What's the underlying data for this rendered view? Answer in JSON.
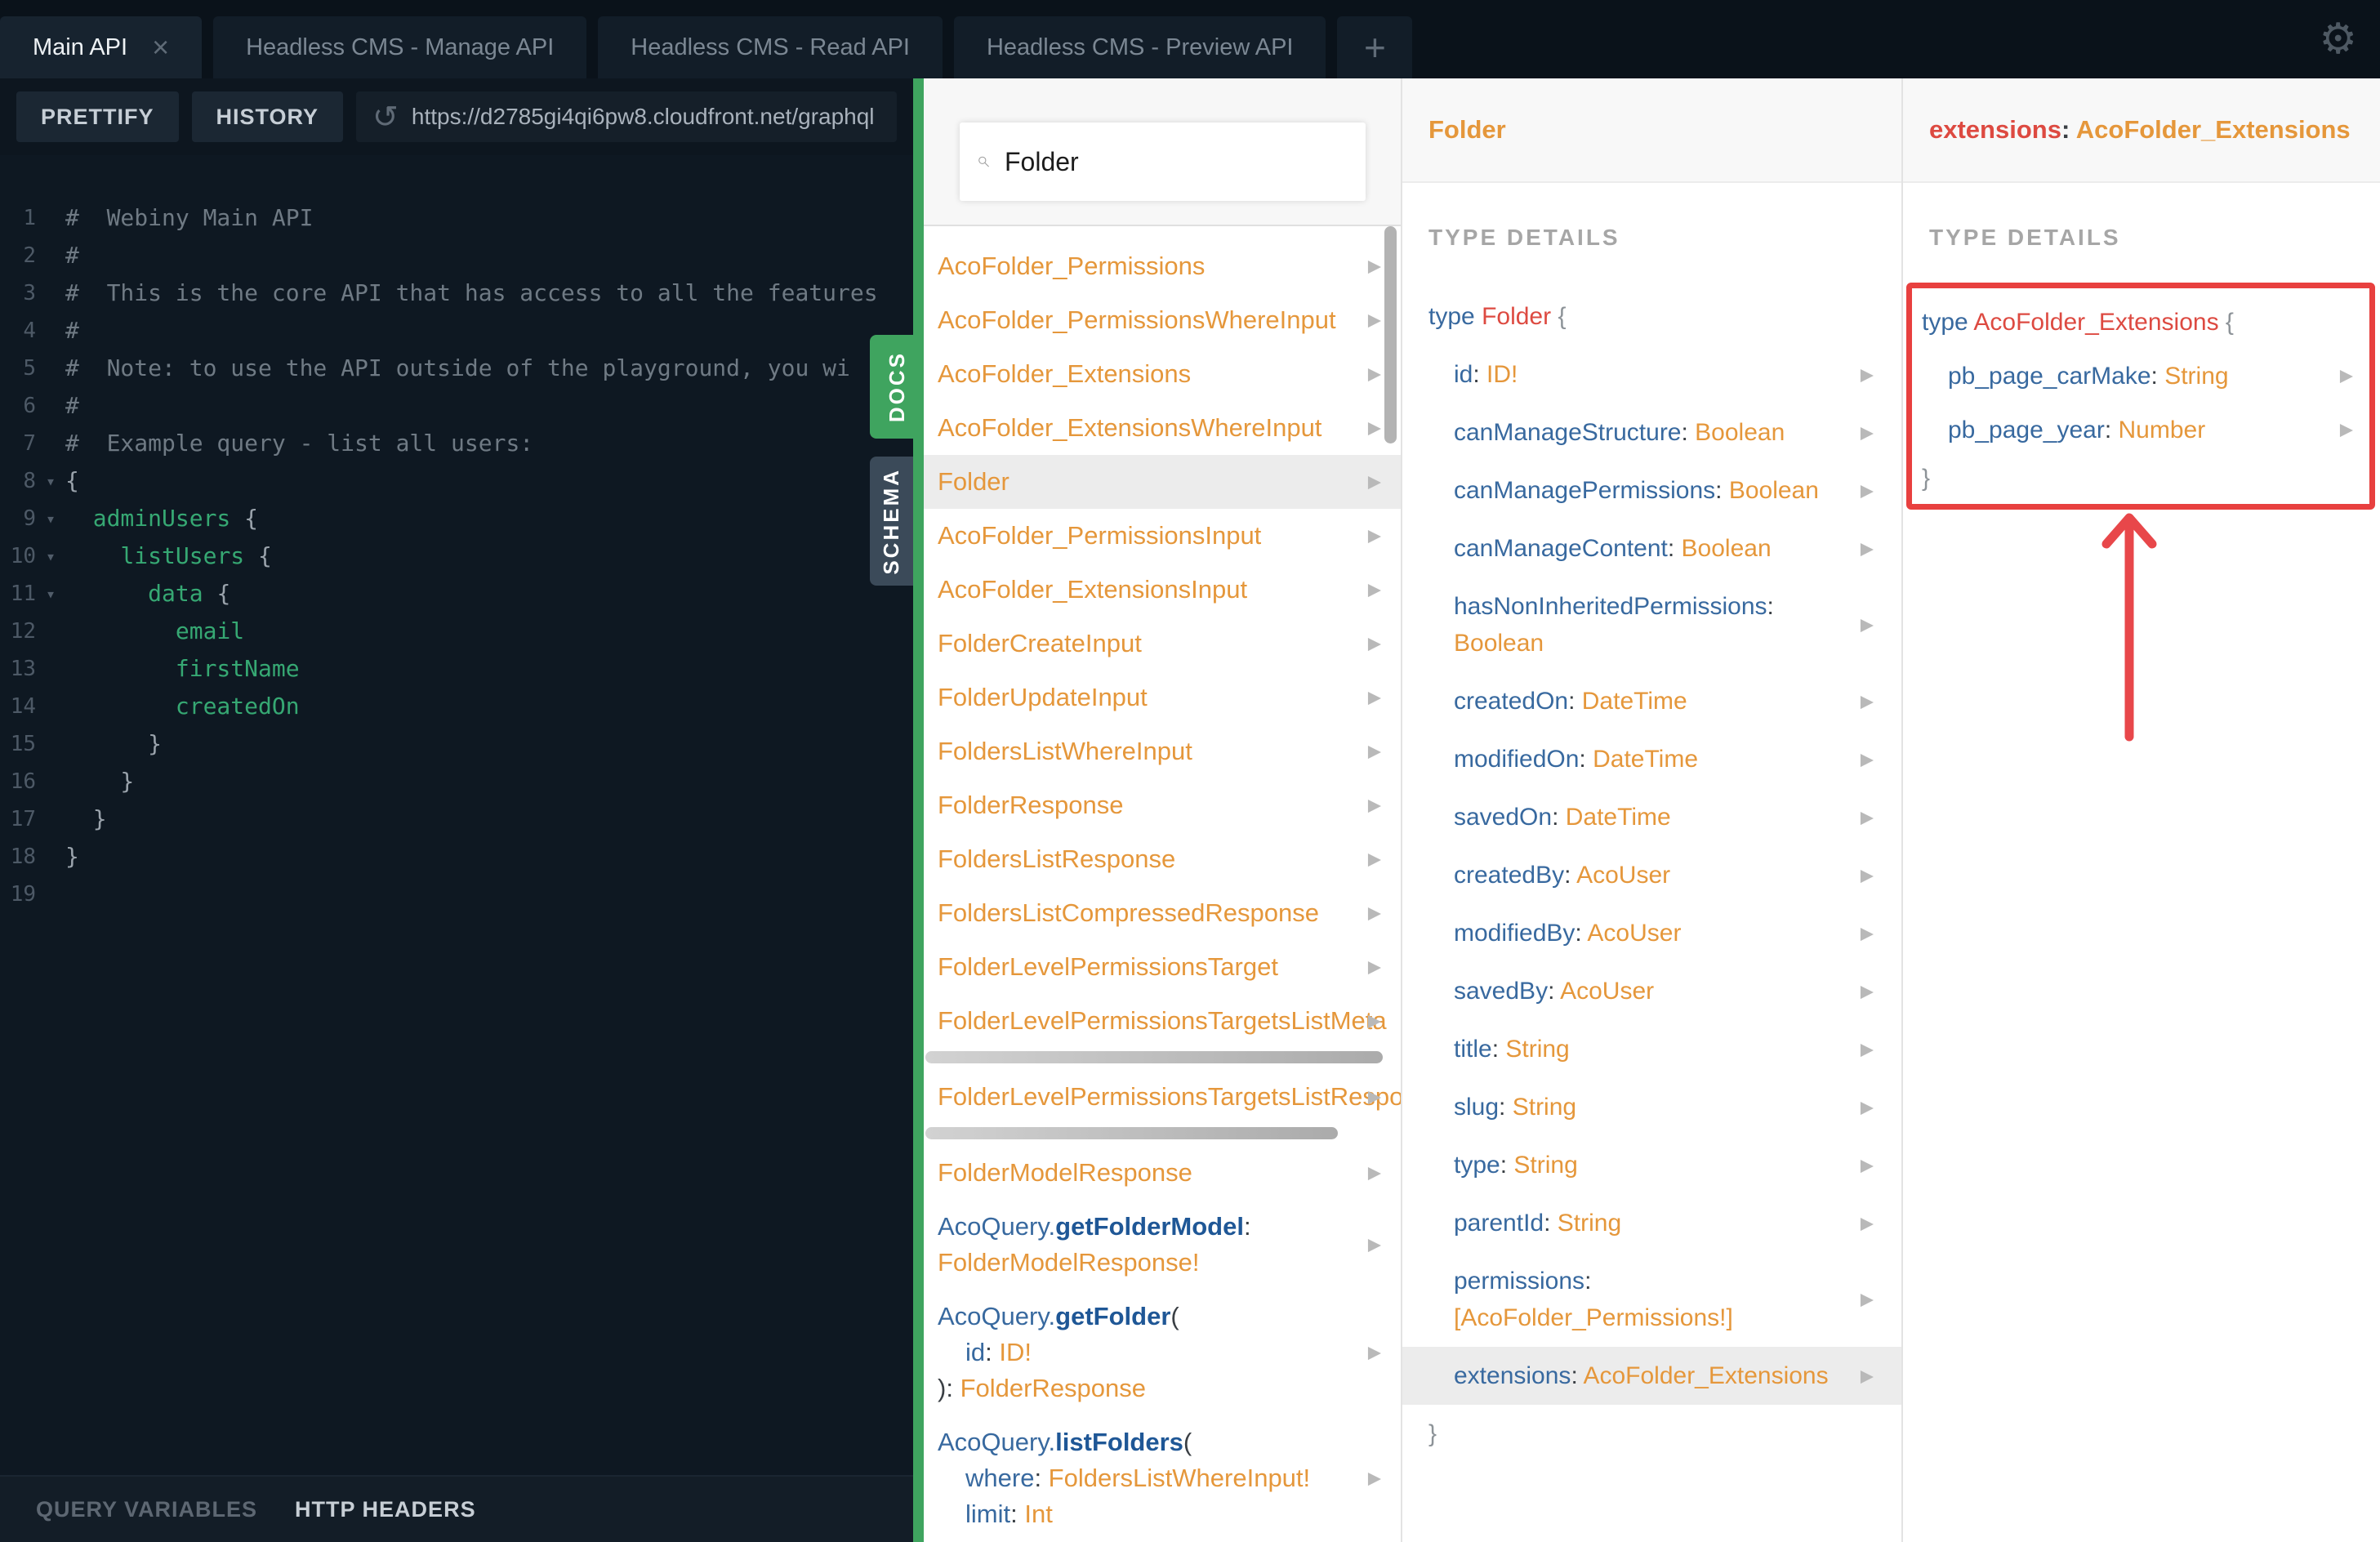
{
  "colors": {
    "accent_green": "#3fa45f",
    "type_orange": "#e5973b",
    "field_blue": "#38699f",
    "keyword_red": "#dd4a41",
    "annotation_red": "#e8403f",
    "editor_green": "#36a873",
    "dark_bg": "#0e1822"
  },
  "topbar": {
    "tabs": [
      {
        "label": "Main API",
        "active": true,
        "close": "×"
      },
      {
        "label": "Headless CMS - Manage API"
      },
      {
        "label": "Headless CMS - Read API"
      },
      {
        "label": "Headless CMS - Preview API"
      }
    ],
    "add_tab": "+",
    "settings_icon": "⚙"
  },
  "toolbar": {
    "prettify": "PRETTIFY",
    "history": "HISTORY",
    "refresh_icon": "↺",
    "url": "https://d2785gi4qi6pw8.cloudfront.net/graphql"
  },
  "editor": {
    "lines": [
      {
        "n": "1",
        "tks": [
          [
            "c",
            "#  Webiny Main API"
          ]
        ]
      },
      {
        "n": "2",
        "tks": [
          [
            "c",
            "#"
          ]
        ]
      },
      {
        "n": "3",
        "tks": [
          [
            "c",
            "#  This is the core API that has access to all the features"
          ]
        ]
      },
      {
        "n": "4",
        "tks": [
          [
            "c",
            "#"
          ]
        ]
      },
      {
        "n": "5",
        "tks": [
          [
            "c",
            "#  Note: to use the API outside of the playground, you wi"
          ]
        ]
      },
      {
        "n": "6",
        "tks": [
          [
            "c",
            "#"
          ]
        ]
      },
      {
        "n": "7",
        "tks": [
          [
            "c",
            "#  Example query - list all users:"
          ]
        ]
      },
      {
        "n": "8",
        "fold": true,
        "tks": [
          [
            "p",
            "{"
          ]
        ]
      },
      {
        "n": "9",
        "fold": true,
        "tks": [
          [
            "p",
            "  "
          ],
          [
            "f",
            "adminUsers"
          ],
          [
            "p",
            " {"
          ]
        ]
      },
      {
        "n": "10",
        "fold": true,
        "tks": [
          [
            "p",
            "    "
          ],
          [
            "f",
            "listUsers"
          ],
          [
            "p",
            " {"
          ]
        ]
      },
      {
        "n": "11",
        "fold": true,
        "tks": [
          [
            "p",
            "      "
          ],
          [
            "f",
            "data"
          ],
          [
            "p",
            " {"
          ]
        ]
      },
      {
        "n": "12",
        "tks": [
          [
            "p",
            "        "
          ],
          [
            "f",
            "email"
          ]
        ]
      },
      {
        "n": "13",
        "tks": [
          [
            "p",
            "        "
          ],
          [
            "f",
            "firstName"
          ]
        ]
      },
      {
        "n": "14",
        "tks": [
          [
            "p",
            "        "
          ],
          [
            "f",
            "createdOn"
          ]
        ]
      },
      {
        "n": "15",
        "tks": [
          [
            "p",
            "      }"
          ]
        ]
      },
      {
        "n": "16",
        "tks": [
          [
            "p",
            "    }"
          ]
        ]
      },
      {
        "n": "17",
        "tks": [
          [
            "p",
            "  }"
          ]
        ]
      },
      {
        "n": "18",
        "tks": [
          [
            "p",
            "}"
          ]
        ]
      },
      {
        "n": "19",
        "tks": []
      }
    ]
  },
  "footer": {
    "query_variables": "QUERY VARIABLES",
    "http_headers": "HTTP HEADERS"
  },
  "side_tabs": {
    "docs": "DOCS",
    "schema": "SCHEMA"
  },
  "docs": {
    "search_value": "Folder",
    "list": [
      {
        "lines": [
          {
            "tks": [
              [
                "o",
                "AcoFolder_Permissions"
              ]
            ]
          }
        ],
        "arrow": true
      },
      {
        "lines": [
          {
            "tks": [
              [
                "o",
                "AcoFolder_PermissionsWhereInput"
              ]
            ]
          }
        ],
        "arrow": true
      },
      {
        "lines": [
          {
            "tks": [
              [
                "o",
                "AcoFolder_Extensions"
              ]
            ]
          }
        ],
        "arrow": true
      },
      {
        "lines": [
          {
            "tks": [
              [
                "o",
                "AcoFolder_ExtensionsWhereInput"
              ]
            ]
          }
        ],
        "arrow": true
      },
      {
        "lines": [
          {
            "tks": [
              [
                "o",
                "Folder"
              ]
            ]
          }
        ],
        "arrow": true,
        "hl": true
      },
      {
        "lines": [
          {
            "tks": [
              [
                "o",
                "AcoFolder_PermissionsInput"
              ]
            ]
          }
        ],
        "arrow": true
      },
      {
        "lines": [
          {
            "tks": [
              [
                "o",
                "AcoFolder_ExtensionsInput"
              ]
            ]
          }
        ],
        "arrow": true
      },
      {
        "lines": [
          {
            "tks": [
              [
                "o",
                "FolderCreateInput"
              ]
            ]
          }
        ],
        "arrow": true
      },
      {
        "lines": [
          {
            "tks": [
              [
                "o",
                "FolderUpdateInput"
              ]
            ]
          }
        ],
        "arrow": true
      },
      {
        "lines": [
          {
            "tks": [
              [
                "o",
                "FoldersListWhereInput"
              ]
            ]
          }
        ],
        "arrow": true
      },
      {
        "lines": [
          {
            "tks": [
              [
                "o",
                "FolderResponse"
              ]
            ]
          }
        ],
        "arrow": true
      },
      {
        "lines": [
          {
            "tks": [
              [
                "o",
                "FoldersListResponse"
              ]
            ]
          }
        ],
        "arrow": true
      },
      {
        "lines": [
          {
            "tks": [
              [
                "o",
                "FoldersListCompressedResponse"
              ]
            ]
          }
        ],
        "arrow": true
      },
      {
        "lines": [
          {
            "tks": [
              [
                "o",
                "FolderLevelPermissionsTarget"
              ]
            ]
          }
        ],
        "arrow": true
      },
      {
        "lines": [
          {
            "tks": [
              [
                "o",
                "FolderLevelPermissionsTargetsListMeta"
              ]
            ]
          }
        ],
        "arrow": true,
        "hbar": 560
      },
      {
        "lines": [
          {
            "tks": [
              [
                "o",
                "FolderLevelPermissionsTargetsListRespo"
              ]
            ]
          }
        ],
        "arrow": true,
        "hbar": 505
      },
      {
        "lines": [
          {
            "tks": [
              [
                "o",
                "FolderModelResponse"
              ]
            ]
          }
        ],
        "arrow": true
      },
      {
        "lines": [
          {
            "tks": [
              [
                "b",
                "AcoQuery."
              ],
              [
                "bb",
                "getFolderModel"
              ],
              [
                "d",
                ":"
              ]
            ]
          },
          {
            "tks": [
              [
                "o",
                "FolderModelResponse!"
              ]
            ]
          }
        ],
        "arrow": true
      },
      {
        "lines": [
          {
            "tks": [
              [
                "b",
                "AcoQuery."
              ],
              [
                "bb",
                "getFolder"
              ],
              [
                "d",
                "("
              ]
            ]
          },
          {
            "ind": 34,
            "tks": [
              [
                "b",
                "id"
              ],
              [
                "d",
                ": "
              ],
              [
                "o",
                "ID!"
              ]
            ]
          },
          {
            "tks": [
              [
                "d",
                "): "
              ],
              [
                "o",
                "FolderResponse"
              ]
            ]
          }
        ],
        "arrow": true
      },
      {
        "lines": [
          {
            "tks": [
              [
                "b",
                "AcoQuery."
              ],
              [
                "bb",
                "listFolders"
              ],
              [
                "d",
                "("
              ]
            ]
          },
          {
            "ind": 34,
            "tks": [
              [
                "b",
                "where"
              ],
              [
                "d",
                ": "
              ],
              [
                "o",
                "FoldersListWhereInput!"
              ]
            ]
          },
          {
            "ind": 34,
            "tks": [
              [
                "b",
                "limit"
              ],
              [
                "d",
                ": "
              ],
              [
                "o",
                "Int"
              ]
            ]
          }
        ],
        "arrow": true
      }
    ]
  },
  "folder_panel": {
    "title": "Folder",
    "section_label": "TYPE DETAILS",
    "body": [
      {
        "kind": "decl",
        "lines": [
          {
            "tks": [
              [
                "b",
                "type"
              ],
              [
                "d",
                " "
              ],
              [
                "r",
                "Folder"
              ],
              [
                "d",
                " "
              ],
              [
                "g",
                "{"
              ]
            ]
          }
        ]
      },
      {
        "kind": "field",
        "arrow": true,
        "lines": [
          {
            "tks": [
              [
                "b",
                "id"
              ],
              [
                "d",
                ": "
              ],
              [
                "o",
                "ID!"
              ]
            ]
          }
        ]
      },
      {
        "kind": "field",
        "arrow": true,
        "lines": [
          {
            "tks": [
              [
                "b",
                "canManageStructure"
              ],
              [
                "d",
                ": "
              ],
              [
                "o",
                "Boolean"
              ]
            ]
          }
        ]
      },
      {
        "kind": "field",
        "arrow": true,
        "lines": [
          {
            "tks": [
              [
                "b",
                "canManagePermissions"
              ],
              [
                "d",
                ": "
              ],
              [
                "o",
                "Boolean"
              ]
            ]
          }
        ]
      },
      {
        "kind": "field",
        "arrow": true,
        "lines": [
          {
            "tks": [
              [
                "b",
                "canManageContent"
              ],
              [
                "d",
                ": "
              ],
              [
                "o",
                "Boolean"
              ]
            ]
          }
        ]
      },
      {
        "kind": "field",
        "arrow": true,
        "lines": [
          {
            "tks": [
              [
                "b",
                "hasNonInheritedPermissions"
              ],
              [
                "d",
                ":"
              ]
            ]
          },
          {
            "tks": [
              [
                "o",
                "Boolean"
              ]
            ]
          }
        ]
      },
      {
        "kind": "field",
        "arrow": true,
        "lines": [
          {
            "tks": [
              [
                "b",
                "createdOn"
              ],
              [
                "d",
                ": "
              ],
              [
                "o",
                "DateTime"
              ]
            ]
          }
        ]
      },
      {
        "kind": "field",
        "arrow": true,
        "lines": [
          {
            "tks": [
              [
                "b",
                "modifiedOn"
              ],
              [
                "d",
                ": "
              ],
              [
                "o",
                "DateTime"
              ]
            ]
          }
        ]
      },
      {
        "kind": "field",
        "arrow": true,
        "lines": [
          {
            "tks": [
              [
                "b",
                "savedOn"
              ],
              [
                "d",
                ": "
              ],
              [
                "o",
                "DateTime"
              ]
            ]
          }
        ]
      },
      {
        "kind": "field",
        "arrow": true,
        "lines": [
          {
            "tks": [
              [
                "b",
                "createdBy"
              ],
              [
                "d",
                ": "
              ],
              [
                "o",
                "AcoUser"
              ]
            ]
          }
        ]
      },
      {
        "kind": "field",
        "arrow": true,
        "lines": [
          {
            "tks": [
              [
                "b",
                "modifiedBy"
              ],
              [
                "d",
                ": "
              ],
              [
                "o",
                "AcoUser"
              ]
            ]
          }
        ]
      },
      {
        "kind": "field",
        "arrow": true,
        "lines": [
          {
            "tks": [
              [
                "b",
                "savedBy"
              ],
              [
                "d",
                ": "
              ],
              [
                "o",
                "AcoUser"
              ]
            ]
          }
        ]
      },
      {
        "kind": "field",
        "arrow": true,
        "lines": [
          {
            "tks": [
              [
                "b",
                "title"
              ],
              [
                "d",
                ": "
              ],
              [
                "o",
                "String"
              ]
            ]
          }
        ]
      },
      {
        "kind": "field",
        "arrow": true,
        "lines": [
          {
            "tks": [
              [
                "b",
                "slug"
              ],
              [
                "d",
                ": "
              ],
              [
                "o",
                "String"
              ]
            ]
          }
        ]
      },
      {
        "kind": "field",
        "arrow": true,
        "lines": [
          {
            "tks": [
              [
                "b",
                "type"
              ],
              [
                "d",
                ": "
              ],
              [
                "o",
                "String"
              ]
            ]
          }
        ]
      },
      {
        "kind": "field",
        "arrow": true,
        "lines": [
          {
            "tks": [
              [
                "b",
                "parentId"
              ],
              [
                "d",
                ": "
              ],
              [
                "o",
                "String"
              ]
            ]
          }
        ]
      },
      {
        "kind": "field",
        "arrow": true,
        "lines": [
          {
            "tks": [
              [
                "b",
                "permissions"
              ],
              [
                "d",
                ":"
              ]
            ]
          },
          {
            "tks": [
              [
                "o",
                "[AcoFolder_Permissions!]"
              ]
            ]
          }
        ]
      },
      {
        "kind": "field",
        "arrow": true,
        "hl": true,
        "lines": [
          {
            "tks": [
              [
                "b",
                "extensions"
              ],
              [
                "d",
                ": "
              ],
              [
                "o",
                "AcoFolder_Extensions"
              ]
            ]
          }
        ]
      },
      {
        "kind": "close",
        "lines": [
          {
            "tks": [
              [
                "g",
                "}"
              ]
            ]
          }
        ]
      }
    ]
  },
  "extensions_panel": {
    "title_tks": [
      [
        "r",
        "extensions"
      ],
      [
        "d",
        ": "
      ],
      [
        "o",
        "AcoFolder_Extensions"
      ]
    ],
    "section_label": "TYPE DETAILS",
    "body": [
      {
        "kind": "decl",
        "lines": [
          {
            "tks": [
              [
                "b",
                "type"
              ],
              [
                "d",
                " "
              ],
              [
                "r",
                "AcoFolder_Extensions"
              ],
              [
                "d",
                " "
              ],
              [
                "g",
                "{"
              ]
            ]
          }
        ]
      },
      {
        "kind": "field",
        "arrow": true,
        "lines": [
          {
            "tks": [
              [
                "b",
                "pb_page_carMake"
              ],
              [
                "d",
                ": "
              ],
              [
                "o",
                "String"
              ]
            ]
          }
        ]
      },
      {
        "kind": "field",
        "arrow": true,
        "lines": [
          {
            "tks": [
              [
                "b",
                "pb_page_year"
              ],
              [
                "d",
                ": "
              ],
              [
                "o",
                "Number"
              ]
            ]
          }
        ]
      },
      {
        "kind": "close",
        "lines": [
          {
            "tks": [
              [
                "g",
                "}"
              ]
            ]
          }
        ]
      }
    ],
    "annotation": {
      "shape": "box-and-up-arrow",
      "color": "#e8403f"
    }
  }
}
